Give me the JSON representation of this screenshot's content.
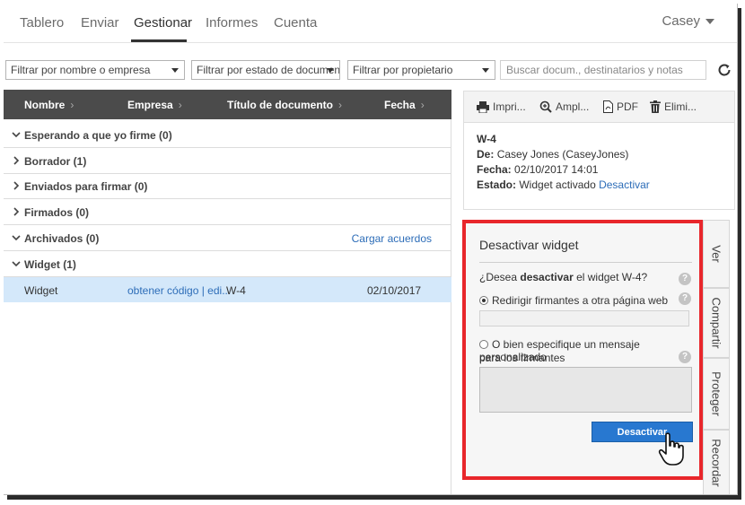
{
  "nav": {
    "tabs": [
      {
        "label": "Tablero"
      },
      {
        "label": "Enviar"
      },
      {
        "label": "Gestionar"
      },
      {
        "label": "Informes"
      },
      {
        "label": "Cuenta"
      }
    ],
    "active_tab": "Gestionar",
    "user": "Casey"
  },
  "filters": {
    "by_name": "Filtrar por nombre o empresa",
    "by_status": "Filtrar por estado de documen",
    "by_owner": "Filtrar por propietario",
    "search_placeholder": "Buscar docum., destinatarios y notas"
  },
  "list": {
    "columns": [
      "Nombre",
      "Empresa",
      "Título de documento",
      "Fecha"
    ],
    "groups": [
      {
        "label": "Esperando a que yo firme (0)",
        "expanded": true
      },
      {
        "label": "Borrador (1)",
        "expanded": false
      },
      {
        "label": "Enviados para firmar (0)",
        "expanded": false
      },
      {
        "label": "Firmados (0)",
        "expanded": false
      },
      {
        "label": "Archivados (0)",
        "expanded": true,
        "action": "Cargar acuerdos"
      },
      {
        "label": "Widget (1)",
        "expanded": true
      }
    ],
    "selected_row": {
      "name": "Widget",
      "company_links": "obtener código | edi...",
      "title": "W-4",
      "date": "02/10/2017"
    }
  },
  "detail": {
    "toolbar": {
      "print": "Impri...",
      "zoom": "Ampl...",
      "pdf": "PDF",
      "delete": "Elimi..."
    },
    "doc_title": "W-4",
    "from_label": "De:",
    "from_value": "Casey Jones (CaseyJones)",
    "date_label": "Fecha:",
    "date_value": "02/10/2017 14:01",
    "status_label": "Estado:",
    "status_value": "Widget activado",
    "status_action": "Desactivar"
  },
  "side_tabs": [
    "Ver",
    "Compartir",
    "Proteger",
    "Recordar"
  ],
  "panel": {
    "title": "Desactivar widget",
    "question_prefix": "¿Desea ",
    "question_bold": "desactivar",
    "question_suffix": " el widget W-4?",
    "option_redirect": "Redirigir firmantes a otra página web",
    "option_message_line1": "O bien especifique un mensaje personalizado",
    "option_message_line2": "para los firmantes",
    "help_glyph": "?",
    "button": "Desactivar"
  },
  "colors": {
    "header_bg": "#4b4b4b",
    "selected_row_bg": "#d4e8fa",
    "link": "#2d6db8",
    "highlight_border": "#e8262b",
    "primary_button": "#2878d0"
  }
}
